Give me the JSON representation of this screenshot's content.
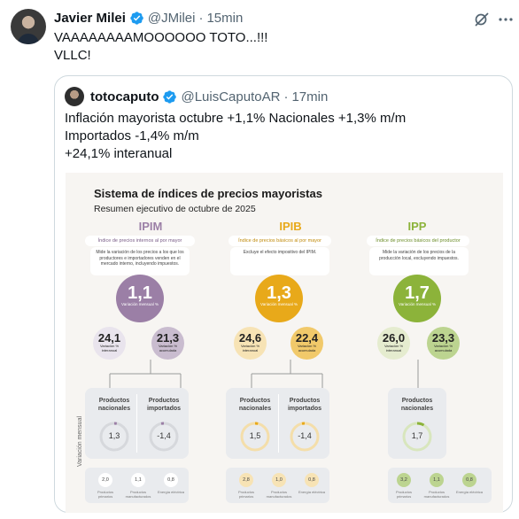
{
  "tweet": {
    "author_name": "Javier Milei",
    "handle": "@JMilei",
    "separator": "·",
    "time": "15min",
    "text_line1": "VAAAAAAAAMOOOOOO TOTO...!!!",
    "text_line2": "VLLC!"
  },
  "quote": {
    "author_name": "totocaputo",
    "handle": "@LuisCaputoAR",
    "separator": "·",
    "time": "17min",
    "text_line1": "Inflación mayorista octubre +1,1% Nacionales +1,3% m/m",
    "text_line2": "Importados -1,4% m/m",
    "text_line3": "+24,1% interanual"
  },
  "infographic": {
    "title": "Sistema de índices de precios mayoristas",
    "subtitle": "Resumen ejecutivo de octubre de 2025",
    "vertical_label": "Variación mensual",
    "monthly_label": "Variación mensual %",
    "interannual_label": "Variación % interanual",
    "cumulative_label": "Variación % acumulada",
    "columns": [
      {
        "name": "IPIM",
        "pill": "Índice de precios internos al por mayor",
        "description": "Mide la variación de los precios a los que los productores e importadores venden en el mercado interno, incluyendo impuestos.",
        "monthly": "1,1",
        "interannual": "24,1",
        "cumulative": "21,3",
        "products": [
          {
            "label_1": "Productos",
            "label_2": "nacionales",
            "value": "1,3"
          },
          {
            "label_1": "Productos",
            "label_2": "importados",
            "value": "-1,4"
          }
        ],
        "bottom": [
          {
            "value": "2,0",
            "label": "Productos primarios"
          },
          {
            "value": "1,1",
            "label": "Productos manufacturados"
          },
          {
            "value": "0,8",
            "label": "Energía eléctrica"
          }
        ]
      },
      {
        "name": "IPIB",
        "pill": "Índice de precios básicos al por mayor",
        "description": "Excluye el efecto impositivo del IPIM.",
        "monthly": "1,3",
        "interannual": "24,6",
        "cumulative": "22,4",
        "products": [
          {
            "label_1": "Productos",
            "label_2": "nacionales",
            "value": "1,5"
          },
          {
            "label_1": "Productos",
            "label_2": "importados",
            "value": "-1,4"
          }
        ],
        "bottom": [
          {
            "value": "2,8",
            "label": "Productos primarios"
          },
          {
            "value": "1,0",
            "label": "Productos manufacturados"
          },
          {
            "value": "0,8",
            "label": "Energía eléctrica"
          }
        ]
      },
      {
        "name": "IPP",
        "pill": "Índice de precios básicos del productor",
        "description": "Mide la variación de los precios de la producción local, excluyendo impuestos.",
        "monthly": "1,7",
        "interannual": "26,0",
        "cumulative": "23,3",
        "products": [
          {
            "label_1": "Productos",
            "label_2": "nacionales",
            "value": "1,7"
          }
        ],
        "bottom": [
          {
            "value": "3,2",
            "label": "Productos primarios"
          },
          {
            "value": "1,1",
            "label": "Productos manufacturados"
          },
          {
            "value": "0,8",
            "label": "Energía eléctrica"
          }
        ]
      }
    ]
  },
  "colors": {
    "ipim": "#9b7fa6",
    "ipib": "#e8a91a",
    "ipp": "#8cb33a",
    "verified": "#1d9bf0",
    "muted": "#536471",
    "border": "#cfd9de"
  },
  "icons": {
    "verified": "verified-badge-icon",
    "grok": "grok-icon",
    "more": "more-icon"
  }
}
